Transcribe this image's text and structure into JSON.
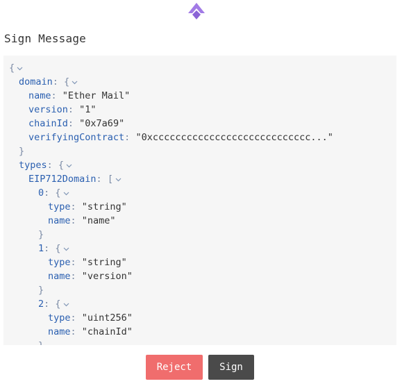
{
  "app": {
    "logo": "wallet-logo-icon",
    "accent_color": "#9a74e0"
  },
  "header": {
    "title": "Sign Message"
  },
  "message": {
    "lines": [
      {
        "indent": 0,
        "key": "",
        "sep": "",
        "value": "{",
        "caret": true
      },
      {
        "indent": 1,
        "key": "domain",
        "sep": ": ",
        "value": "{",
        "caret": true
      },
      {
        "indent": 2,
        "key": "name",
        "sep": ": ",
        "value": "\"Ether Mail\"",
        "caret": false
      },
      {
        "indent": 2,
        "key": "version",
        "sep": ": ",
        "value": "\"1\"",
        "caret": false
      },
      {
        "indent": 2,
        "key": "chainId",
        "sep": ": ",
        "value": "\"0x7a69\"",
        "caret": false
      },
      {
        "indent": 2,
        "key": "verifyingContract",
        "sep": ": ",
        "value": "\"0xcccccccccccccccccccccccccccc...\"",
        "caret": false
      },
      {
        "indent": 1,
        "key": "",
        "sep": "",
        "value": "}",
        "caret": false
      },
      {
        "indent": 1,
        "key": "types",
        "sep": ": ",
        "value": "{",
        "caret": true
      },
      {
        "indent": 2,
        "key": "EIP712Domain",
        "sep": ": ",
        "value": "[",
        "caret": true
      },
      {
        "indent": 3,
        "key": "0",
        "sep": ": ",
        "value": "{",
        "caret": true
      },
      {
        "indent": 4,
        "key": "type",
        "sep": ": ",
        "value": "\"string\"",
        "caret": false
      },
      {
        "indent": 4,
        "key": "name",
        "sep": ": ",
        "value": "\"name\"",
        "caret": false
      },
      {
        "indent": 3,
        "key": "",
        "sep": "",
        "value": "}",
        "caret": false
      },
      {
        "indent": 3,
        "key": "1",
        "sep": ": ",
        "value": "{",
        "caret": true
      },
      {
        "indent": 4,
        "key": "type",
        "sep": ": ",
        "value": "\"string\"",
        "caret": false
      },
      {
        "indent": 4,
        "key": "name",
        "sep": ": ",
        "value": "\"version\"",
        "caret": false
      },
      {
        "indent": 3,
        "key": "",
        "sep": "",
        "value": "}",
        "caret": false
      },
      {
        "indent": 3,
        "key": "2",
        "sep": ": ",
        "value": "{",
        "caret": true
      },
      {
        "indent": 4,
        "key": "type",
        "sep": ": ",
        "value": "\"uint256\"",
        "caret": false
      },
      {
        "indent": 4,
        "key": "name",
        "sep": ": ",
        "value": "\"chainId\"",
        "caret": false
      },
      {
        "indent": 3,
        "key": "",
        "sep": "",
        "value": "}",
        "caret": false
      }
    ]
  },
  "actions": {
    "reject_label": "Reject",
    "sign_label": "Sign"
  }
}
